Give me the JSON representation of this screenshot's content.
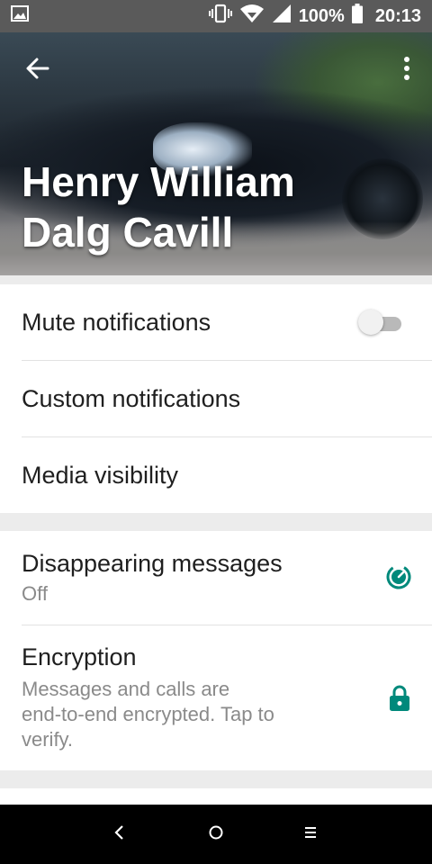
{
  "status_bar": {
    "battery_percent": "100%",
    "time": "20:13"
  },
  "header": {
    "contact_name": "Henry William\nDalg Cavill"
  },
  "settings": {
    "mute_notifications": {
      "label": "Mute notifications",
      "enabled": false
    },
    "custom_notifications": {
      "label": "Custom notifications"
    },
    "media_visibility": {
      "label": "Media visibility"
    }
  },
  "privacy": {
    "disappearing_messages": {
      "label": "Disappearing messages",
      "value": "Off"
    },
    "encryption": {
      "label": "Encryption",
      "description": "Messages and calls are\nend-to-end encrypted. Tap to\nverify."
    }
  },
  "colors": {
    "accent": "#00897b",
    "status_bar": "#5a5a5a",
    "toggle_track_off": "#b9b9b9"
  },
  "icons": {
    "back": "arrow-left-icon",
    "overflow": "more-vertical-icon",
    "disappearing": "timer-icon",
    "encryption": "lock-icon"
  }
}
